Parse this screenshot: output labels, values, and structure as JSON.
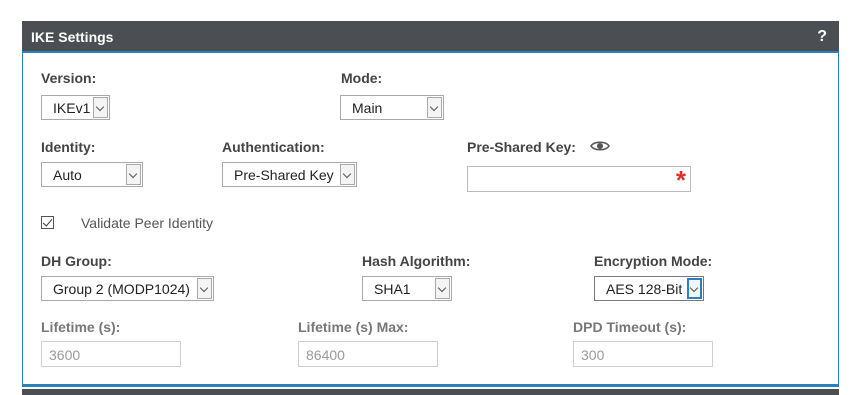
{
  "panel": {
    "title": "IKE Settings",
    "help": "?"
  },
  "version": {
    "label": "Version:",
    "value": "IKEv1"
  },
  "mode": {
    "label": "Mode:",
    "value": "Main"
  },
  "identity": {
    "label": "Identity:",
    "value": "Auto"
  },
  "authentication": {
    "label": "Authentication:",
    "value": "Pre-Shared Key"
  },
  "psk": {
    "label": "Pre-Shared Key:",
    "value": "",
    "required_marker": "*"
  },
  "validate_peer": {
    "label": "Validate Peer Identity",
    "checked": true
  },
  "dh_group": {
    "label": "DH Group:",
    "value": "Group 2 (MODP1024)"
  },
  "hash": {
    "label": "Hash Algorithm:",
    "value": "SHA1"
  },
  "encryption": {
    "label": "Encryption Mode:",
    "value": "AES 128-Bit"
  },
  "lifetime": {
    "label": "Lifetime (s):",
    "value": "3600"
  },
  "lifetime_max": {
    "label": "Lifetime (s) Max:",
    "value": "86400"
  },
  "dpd_timeout": {
    "label": "DPD Timeout (s):",
    "value": "300"
  },
  "colors": {
    "header_bg": "#4b4f53",
    "accent": "#2b80c0",
    "required": "#e0302a"
  }
}
